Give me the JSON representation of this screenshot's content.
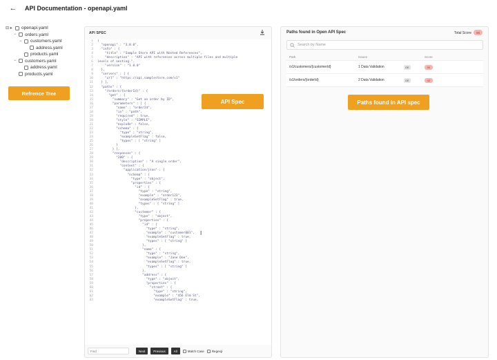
{
  "header": {
    "back_icon": "arrow-left-icon",
    "title": "API Documentation - openapi.yaml"
  },
  "tree": {
    "items": [
      {
        "label": "openapi.yaml",
        "toggle": "⊖ ▸"
      },
      {
        "label": "orders.yaml",
        "toggle": "⊖"
      },
      {
        "label": "customers.yaml",
        "toggle": "⊖"
      },
      {
        "label": "address.yaml",
        "toggle": ""
      },
      {
        "label": "products.yaml",
        "toggle": ""
      },
      {
        "label": "customers.yaml",
        "toggle": "⊖"
      },
      {
        "label": "address.yaml",
        "toggle": ""
      },
      {
        "label": "products.yaml",
        "toggle": ""
      }
    ],
    "tag": "Refrence Tree"
  },
  "spec": {
    "title": "API SPEC",
    "download_icon": "download-icon",
    "tag": "API Spec",
    "lines": [
      "{",
      "  \"openapi\" : \"3.0.0\",",
      "  \"info\" : {",
      "    \"title\" : \"Sample Store API with Nested References\",",
      "    \"description\" : \"API with references across multiple files and multiple",
      "levels of nesting.\",",
      "    \"version\" : \"1.0.0\"",
      "  },",
      "  \"servers\" : [ {",
      "    \"url\" : \"https://api.samplestore.com/v1\"",
      "  } ],",
      "  \"paths\" : {",
      "    \"/orders/{orderId}\" : {",
      "      \"get\" : {",
      "        \"summary\" : \"Get an order by ID\",",
      "        \"parameters\" : [ {",
      "          \"name\" : \"orderId\",",
      "          \"in\" : \"path\",",
      "          \"required\" : true,",
      "          \"style\" : \"SIMPLE\",",
      "          \"explode\" : false,",
      "          \"schema\" : {",
      "            \"type\" : \"string\",",
      "            \"exampleSetFlag\" : false,",
      "            \"types\" : [ \"string\" ]",
      "          }",
      "        } ],",
      "        \"responses\" : {",
      "          \"200\" : {",
      "            \"description\" : \"A single order\",",
      "            \"content\" : {",
      "              \"application/json\" : {",
      "                \"schema\" : {",
      "                  \"type\" : \"object\",",
      "                  \"properties\" : {",
      "                    \"id\" : {",
      "                      \"type\" : \"string\",",
      "                      \"example\" : \"order123\",",
      "                      \"exampleSetFlag\" : true,",
      "                      \"types\" : [ \"string\" ]",
      "                    },",
      "                    \"customer\" : {",
      "                      \"type\" : \"object\",",
      "                      \"properties\" : {",
      "                        \"id\" : {",
      "                          \"type\" : \"string\",",
      "                          \"example\" : \"customer001\",",
      "                          \"exampleSetFlag\" : true,",
      "                          \"types\" : [ \"string\" ]",
      "                        },",
      "                        \"name\" : {",
      "                          \"type\" : \"string\",",
      "                          \"example\" : \"Jane Doe\",",
      "                          \"exampleSetFlag\" : true,",
      "                          \"types\" : [ \"string\" ]",
      "                        },",
      "                        \"address\" : {",
      "                          \"type\" : \"object\",",
      "                          \"properties\" : {",
      "                            \"street\" : {",
      "                              \"type\" : \"string\",",
      "                              \"example\" : \"456 Elm St\",",
      "                              \"exampleSetFlag\" : true,"
    ],
    "find_placeholder": "Find",
    "next_label": "Next",
    "previous_label": "Previous",
    "all_label": "All",
    "match_case_label": "Match Case",
    "regexp_label": "Regexp"
  },
  "paths": {
    "title": "Paths found in Open API Spec",
    "total_score_label": "Total Score",
    "total_score": "00",
    "search_placeholder": "Search by Name",
    "search_icon": "search-icon",
    "columns": [
      "Path",
      "Issues",
      "",
      "Score"
    ],
    "rows": [
      {
        "path": "/v1/customers/{customerId}",
        "issues": "1 Data Validation",
        "method": "GE",
        "score": "00"
      },
      {
        "path": "/v1/orders/{orderId}",
        "issues": "2 Data Validation",
        "method": "GE",
        "score": "42"
      }
    ],
    "tag": "Paths found in API spec"
  },
  "colors": {
    "accent_tag": "#f0a020",
    "score_bg": "#f5b5b0"
  }
}
